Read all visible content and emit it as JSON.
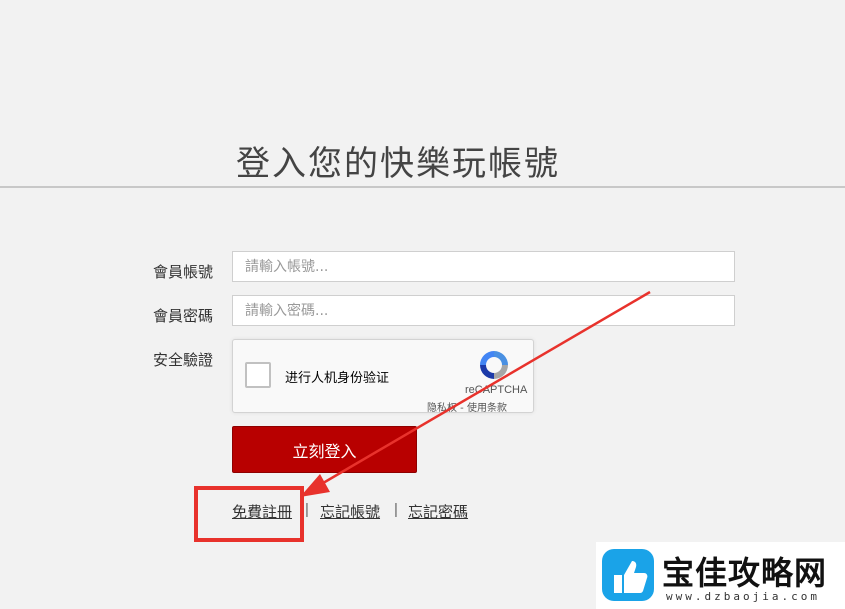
{
  "page": {
    "title": "登入您的快樂玩帳號"
  },
  "form": {
    "account_label": "會員帳號",
    "account_placeholder": "請輸入帳號...",
    "password_label": "會員密碼",
    "password_placeholder": "請輸入密碼...",
    "captcha_label": "安全驗證",
    "login_button": "立刻登入"
  },
  "recaptcha": {
    "checkbox_text": "进行人机身份验证",
    "brand": "reCAPTCHA",
    "links": "隐私权 - 使用条款"
  },
  "links": {
    "register": "免費註冊",
    "forgot_account": "忘記帳號",
    "forgot_password": "忘記密碼",
    "separator": "|"
  },
  "annotation": {
    "highlight_color": "#e8322c"
  },
  "watermark": {
    "name": "宝佳攻略网",
    "url": "www.dzbaojia.com"
  }
}
